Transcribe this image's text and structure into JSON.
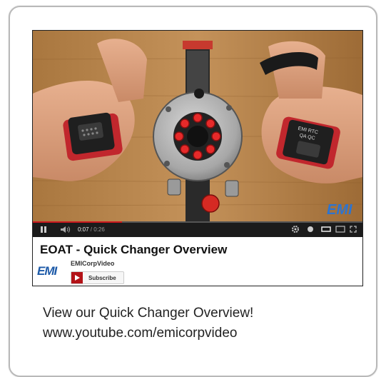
{
  "video": {
    "watermark": "EMI",
    "controls": {
      "play_icon": "pause-icon",
      "volume_icon": "volume-icon",
      "time_current": "0:07",
      "time_separator": " / ",
      "time_total": "0:26",
      "progress": 0.27,
      "settings_icon": "gear-icon",
      "info_icon": "info-icon",
      "theater_icon": "theater-mode-icon",
      "fullscreen_icon": "fullscreen-icon"
    },
    "title": "EOAT - Quick Changer Overview",
    "channel": "EMICorpVideo",
    "channel_logo": "EMI",
    "subscribe_label": "Subscribe",
    "device_label_line1": "EMI RTC",
    "device_label_line2": "QA QC"
  },
  "caption": {
    "line1": "View our Quick Changer Overview!",
    "line2": "www.youtube.com/emicorpvideo"
  },
  "colors": {
    "border": "#b9b9b9",
    "brand_blue": "#1d5aa8",
    "subscribe_red": "#b31217",
    "progress_red": "#cc181e"
  }
}
